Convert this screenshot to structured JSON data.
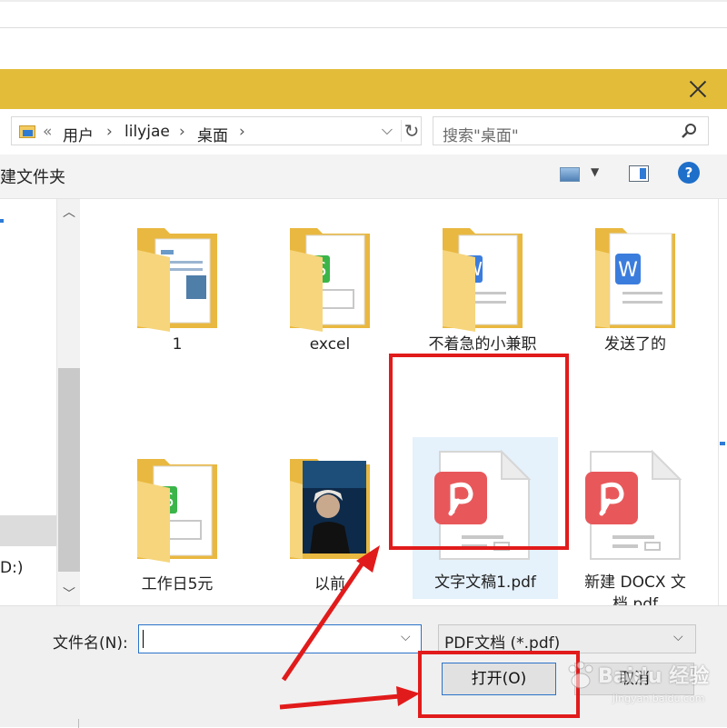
{
  "address": {
    "history_marker": "«",
    "crumbs": [
      "用户",
      "lilyjae",
      "桌面"
    ],
    "separator": "›",
    "dropdown": "⌵",
    "refresh": "↻"
  },
  "search": {
    "placeholder": "搜索\"桌面\""
  },
  "toolbar": {
    "new_folder": "建文件夹",
    "help": "?"
  },
  "nav": {
    "drive_label": "D:)"
  },
  "files": [
    {
      "label": "1",
      "type": "folder",
      "preview": "document"
    },
    {
      "label": "excel",
      "type": "folder",
      "preview": "sheet"
    },
    {
      "label": "不着急的小兼职",
      "type": "folder",
      "preview": "word"
    },
    {
      "label": "发送了的",
      "type": "folder",
      "preview": "word"
    },
    {
      "label": "工作日5元",
      "type": "folder",
      "preview": "sheet"
    },
    {
      "label": "以前",
      "type": "folder",
      "preview": "photo"
    },
    {
      "label": "文字文稿1.pdf",
      "type": "pdf",
      "selected": true
    },
    {
      "label": "新建 DOCX 文\n档.pdf",
      "type": "pdf"
    }
  ],
  "bottom": {
    "filename_label": "文件名(N):",
    "filename_value": "",
    "filetype": "PDF文档 (*.pdf)",
    "open_label": "打开(O)",
    "cancel_label": "取消"
  },
  "watermark": {
    "text": "Baidu 经验",
    "sub": "jingyan.baidu.com"
  },
  "colors": {
    "title_bar": "#e3bd3a",
    "annotation_red": "#e11b1b",
    "selection": "#e5f1fb",
    "pdf_red": "#e8585b",
    "sheet_green": "#3bb54a",
    "word_blue": "#3b7ddd",
    "folder_yellow": "#f3cb60"
  }
}
